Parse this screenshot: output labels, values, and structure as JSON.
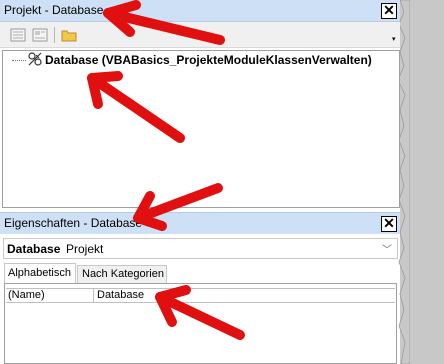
{
  "project_explorer": {
    "title": "Projekt - Database",
    "close_icon": "close-icon",
    "toolbar": [
      "view-code-icon",
      "view-object-icon",
      "toggle-folders-icon"
    ],
    "tree_item_label": "Database (VBABasics_ProjekteModuleKlassenVerwalten)",
    "tree_item_icon": "database-project-icon"
  },
  "properties": {
    "title": "Eigenschaften - Database",
    "close_icon": "close-icon",
    "object_name": "Database",
    "object_type": "Projekt",
    "tabs": [
      {
        "label": "Alphabetisch",
        "active": true
      },
      {
        "label": "Nach Kategorien",
        "active": false
      }
    ],
    "rows": [
      {
        "name": "(Name)",
        "value": "Database"
      }
    ]
  },
  "annotation_color": "#e01010",
  "colors": {
    "title_bar": "#cde0f5",
    "toolbar": "#f0f0f0"
  }
}
